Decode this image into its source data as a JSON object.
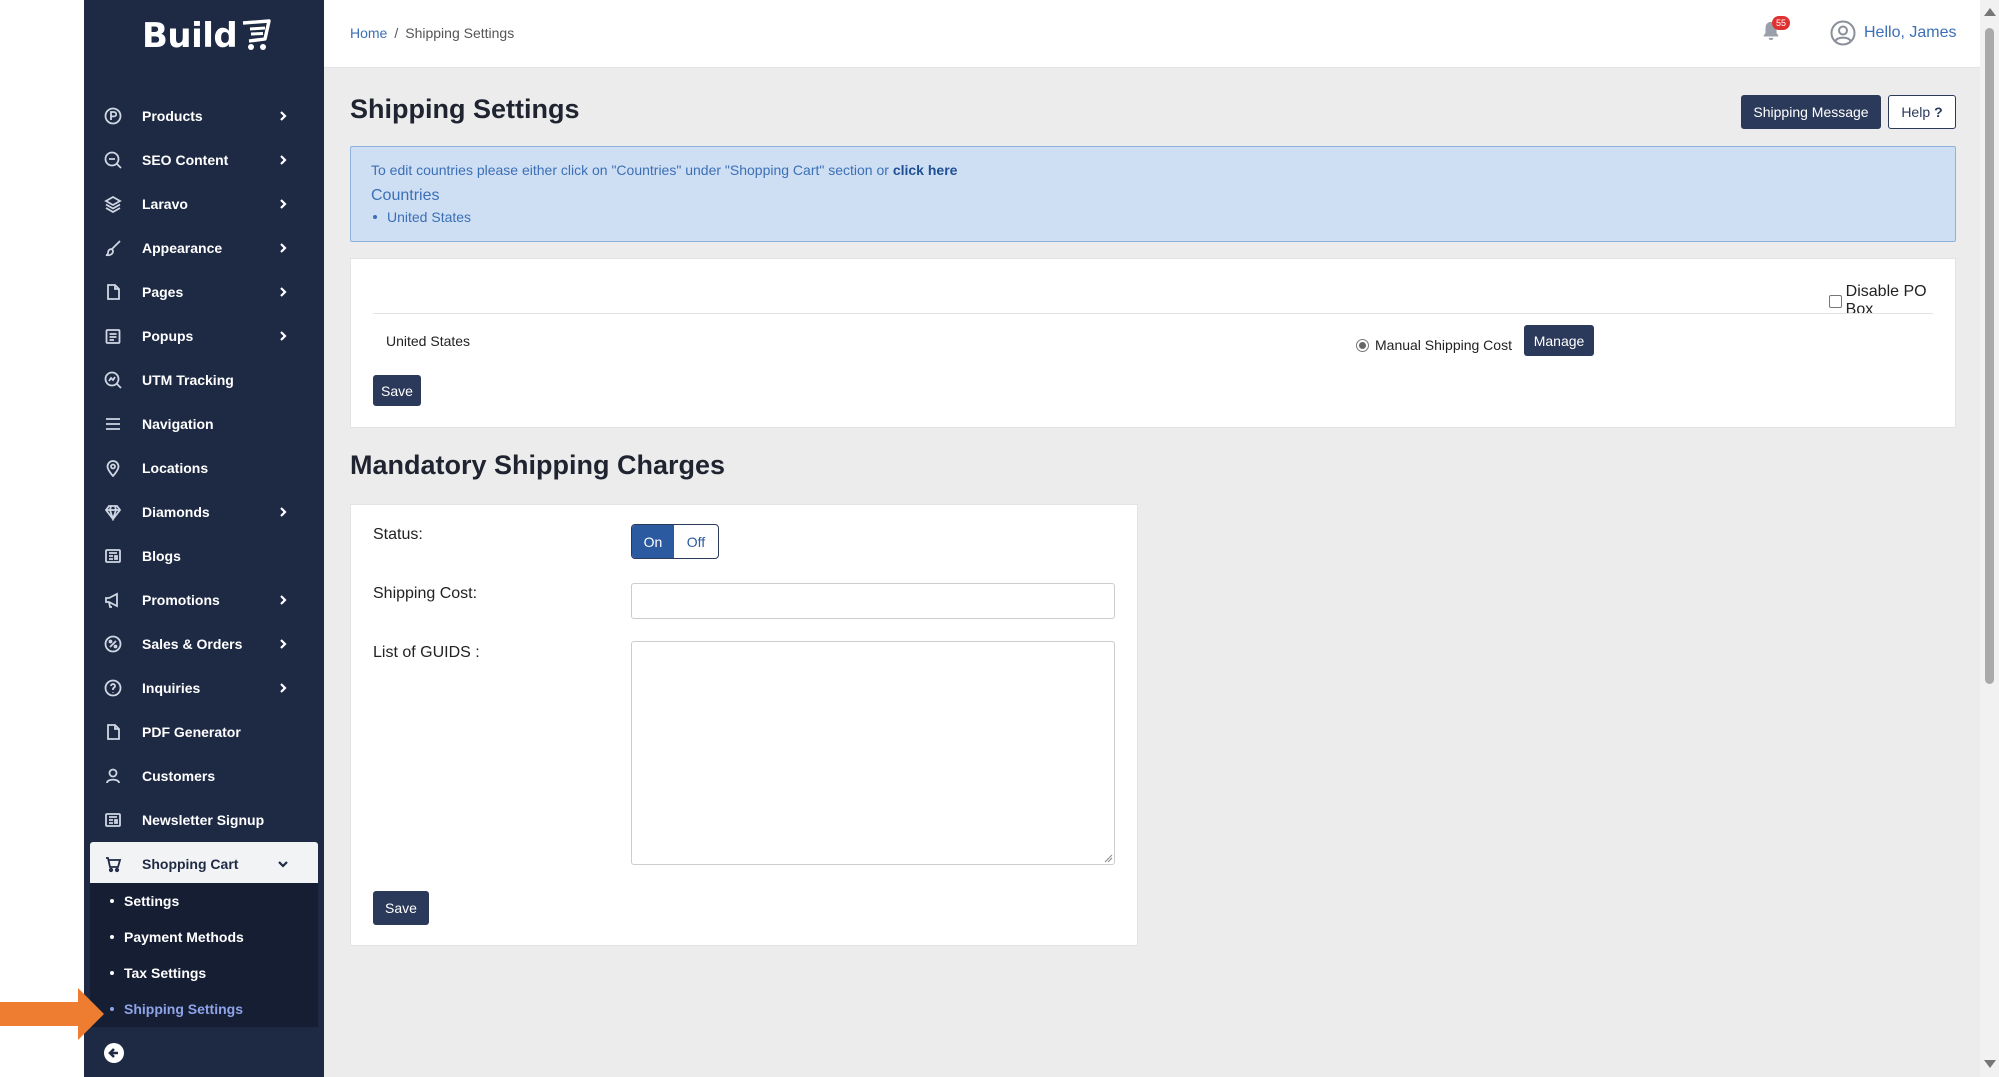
{
  "app": {
    "logo_text": "Build"
  },
  "sidebar": {
    "items": [
      {
        "label": "Products",
        "icon": "products-icon",
        "chevron": true
      },
      {
        "label": "SEO Content",
        "icon": "seo-icon",
        "chevron": true
      },
      {
        "label": "Laravo",
        "icon": "layers-icon",
        "chevron": true
      },
      {
        "label": "Appearance",
        "icon": "brush-icon",
        "chevron": true
      },
      {
        "label": "Pages",
        "icon": "page-icon",
        "chevron": true
      },
      {
        "label": "Popups",
        "icon": "popup-icon",
        "chevron": true
      },
      {
        "label": "UTM Tracking",
        "icon": "tracking-icon",
        "chevron": false
      },
      {
        "label": "Navigation",
        "icon": "menu-icon",
        "chevron": false
      },
      {
        "label": "Locations",
        "icon": "location-pin-icon",
        "chevron": false
      },
      {
        "label": "Diamonds",
        "icon": "diamond-icon",
        "chevron": true
      },
      {
        "label": "Blogs",
        "icon": "blog-icon",
        "chevron": false
      },
      {
        "label": "Promotions",
        "icon": "megaphone-icon",
        "chevron": true
      },
      {
        "label": "Sales & Orders",
        "icon": "percent-icon",
        "chevron": true
      },
      {
        "label": "Inquiries",
        "icon": "question-icon",
        "chevron": true
      },
      {
        "label": "PDF Generator",
        "icon": "pdf-icon",
        "chevron": false
      },
      {
        "label": "Customers",
        "icon": "customer-icon",
        "chevron": false
      },
      {
        "label": "Newsletter Signup",
        "icon": "newsletter-icon",
        "chevron": false
      },
      {
        "label": "Shopping Cart",
        "icon": "cart-icon",
        "chevron": true,
        "expanded": true
      }
    ],
    "sub_items": [
      "Settings",
      "Payment Methods",
      "Tax Settings",
      "Shipping Settings"
    ],
    "current_sub_item": "Shipping Settings"
  },
  "header": {
    "breadcrumb": {
      "home": "Home",
      "separator": "/",
      "current": "Shipping Settings"
    },
    "notifications_count": "55",
    "greeting": "Hello, James"
  },
  "page": {
    "title": "Shipping Settings",
    "shipping_message_label": "Shipping Message",
    "help_label": "Help",
    "help_icon": "?",
    "info": {
      "text": "To edit countries please either click on \"Countries\" under \"Shopping Cart\" section or ",
      "link": "click here",
      "heading": "Countries",
      "countries": [
        "United States"
      ]
    },
    "countries_card": {
      "disable_po_box_label": "Disable PO Box",
      "disable_po_box_checked": false,
      "country": "United States",
      "shipping_option_label": "Manual Shipping Cost",
      "shipping_option_selected": true,
      "manage_label": "Manage",
      "save_label": "Save"
    },
    "mandatory": {
      "title": "Mandatory Shipping Charges",
      "status_label": "Status:",
      "toggle_on": "On",
      "toggle_off": "Off",
      "status_value": "On",
      "shipping_cost_label": "Shipping Cost:",
      "shipping_cost_value": "",
      "guids_label": "List of GUIDS :",
      "guids_value": "",
      "save_label": "Save"
    }
  },
  "colors": {
    "sidebar_bg": "#1e2a44",
    "accent_dark": "#2b3a5a",
    "link_blue": "#3b6fb6",
    "info_bg": "#cfdff3",
    "badge_red": "#e03131",
    "arrow_orange": "#ee7d31"
  }
}
